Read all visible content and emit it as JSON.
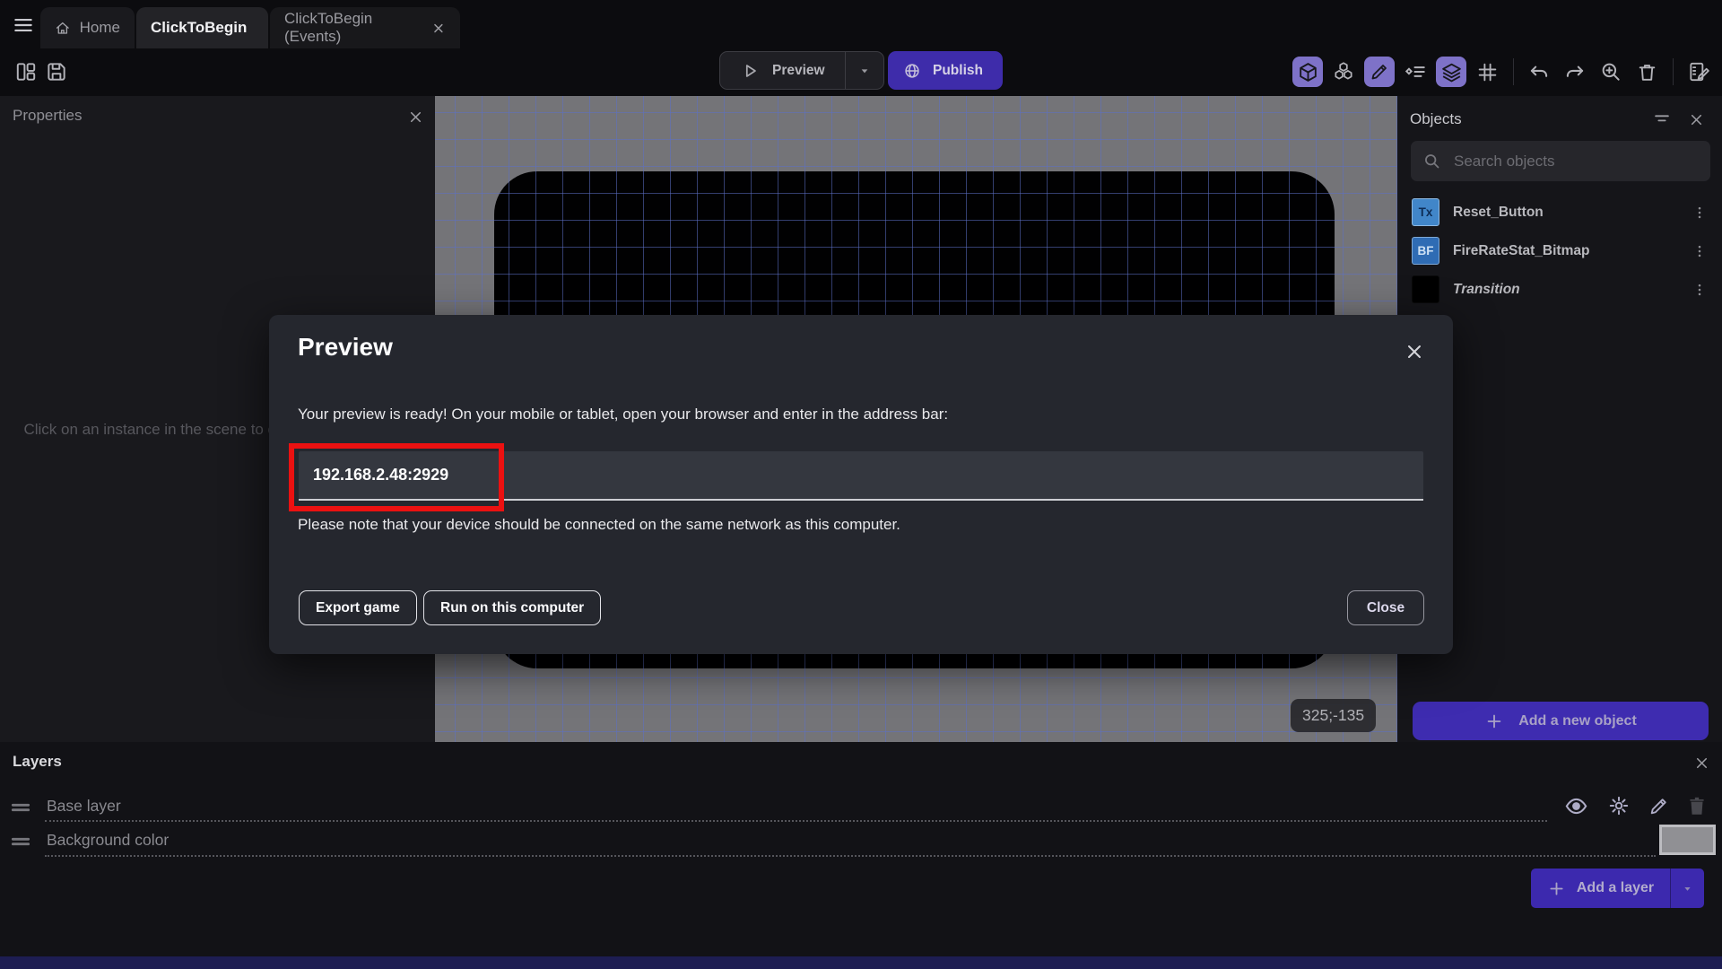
{
  "tabbar": {
    "tabs": [
      {
        "label": "Home"
      },
      {
        "label": "ClickToBegin"
      },
      {
        "label": "ClickToBegin (Events)"
      }
    ]
  },
  "toolbar": {
    "preview_label": "Preview",
    "publish_label": "Publish"
  },
  "properties_panel": {
    "title": "Properties",
    "empty_message": "Click on an instance in the scene to display its properties"
  },
  "canvas": {
    "coords_badge": "325;-135"
  },
  "objects_panel": {
    "title": "Objects",
    "search_placeholder": "Search objects",
    "items": [
      {
        "name": "Reset_Button",
        "icon_label": "Tx"
      },
      {
        "name": "FireRateStat_Bitmap",
        "icon_label": "BF"
      },
      {
        "name": "Transition",
        "icon_label": ""
      }
    ],
    "add_button_label": "Add a new object"
  },
  "layers_panel": {
    "title": "Layers",
    "layers": [
      {
        "name": "Base layer"
      },
      {
        "name": "Background color"
      }
    ],
    "add_button_label": "Add a layer"
  },
  "preview_dialog": {
    "title": "Preview",
    "message": "Your preview is ready! On your mobile or tablet, open your browser and enter in the address bar:",
    "address": "192.168.2.48:2929",
    "note": "Please note that your device should be connected on the same network as this computer.",
    "export_button": "Export game",
    "run_button": "Run on this computer",
    "close_button": "Close"
  },
  "icons": {
    "hamburger-icon": "three horizontal lines",
    "home-icon": "house",
    "project-manager-icon": "layout panels",
    "save-icon": "floppy disk",
    "play-icon": "outlined triangle",
    "caret-down-icon": "small filled triangle",
    "globe-icon": "globe with meridians",
    "cube-3d-icon": "3d box",
    "instances-icon": "stacked cubes",
    "pencil-icon": "pencil",
    "instance-list-icon": "diamond with lines",
    "layers-icon": "stacked sheets",
    "grid-icon": "hash grid",
    "undo-icon": "curved arrow left",
    "redo-icon": "curved arrow right",
    "zoom-in-icon": "magnifier with plus",
    "trash-icon": "trash bin",
    "scene-edit-icon": "notebook with pencil",
    "search-icon": "magnifier",
    "filter-icon": "filter lines",
    "kebab-menu-icon": "three vertical dots",
    "close-icon": "x cross",
    "eye-icon": "eye",
    "effects-icon": "sun sparkle",
    "drag-handle-icon": "two horizontal bars",
    "plus-icon": "plus"
  },
  "colors": {
    "accent_purple": "#3e2caa",
    "toolbar_highlight": "#7e72c8",
    "annotation_red": "#eb1111",
    "canvas_gray": "#747478",
    "grid_blue": "#5d70c6"
  }
}
